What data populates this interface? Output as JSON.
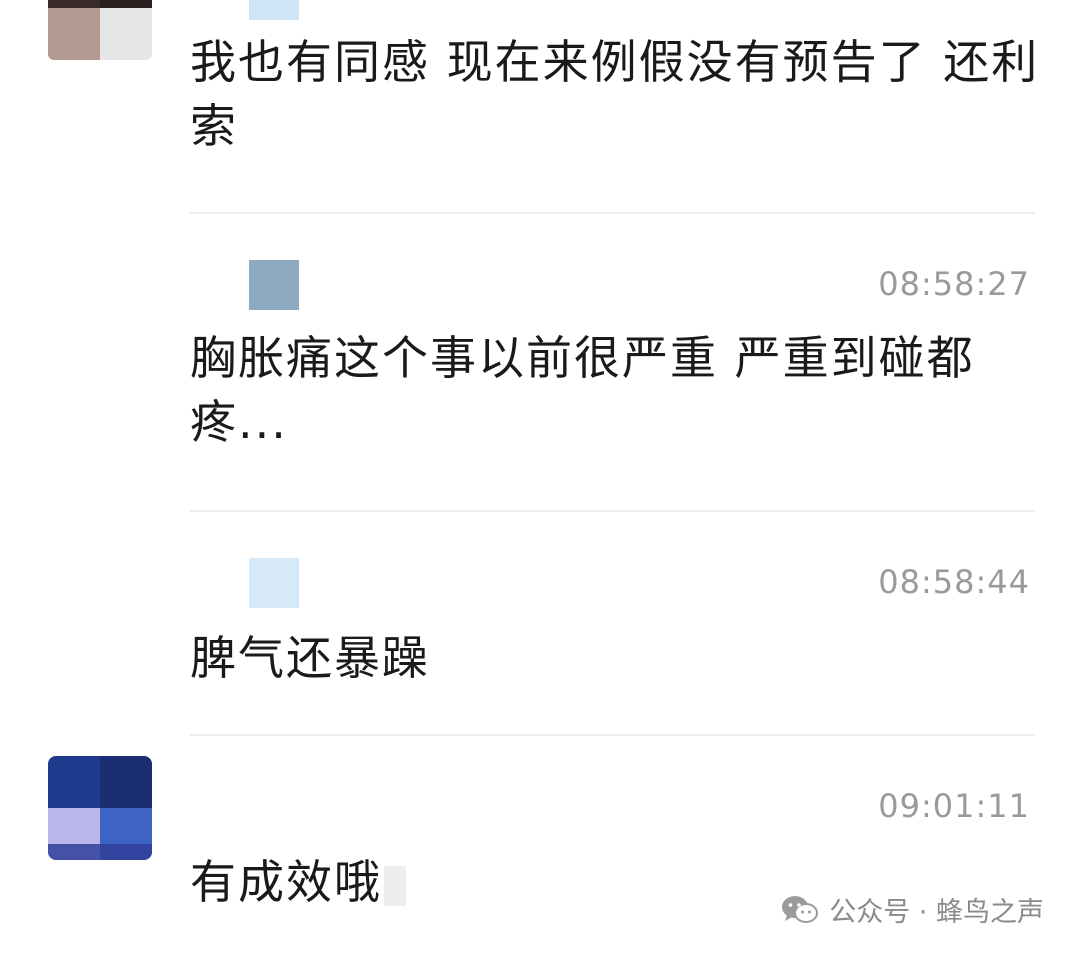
{
  "messages": [
    {
      "text": "我也有同感 现在来例假没有预告了 还利索",
      "time": ""
    },
    {
      "text": "胸胀痛这个事以前很严重 严重到碰都疼...",
      "time": "08:58:27"
    },
    {
      "text": "脾气还暴躁",
      "time": "08:58:44"
    },
    {
      "text": "有成效哦",
      "time": "09:01:11"
    }
  ],
  "watermark": {
    "icon": "wechat-icon",
    "text": "公众号 · 蜂鸟之声"
  },
  "colors": {
    "time": "#9a9a9a",
    "divider": "#ececec",
    "text": "#1a1a1a"
  }
}
